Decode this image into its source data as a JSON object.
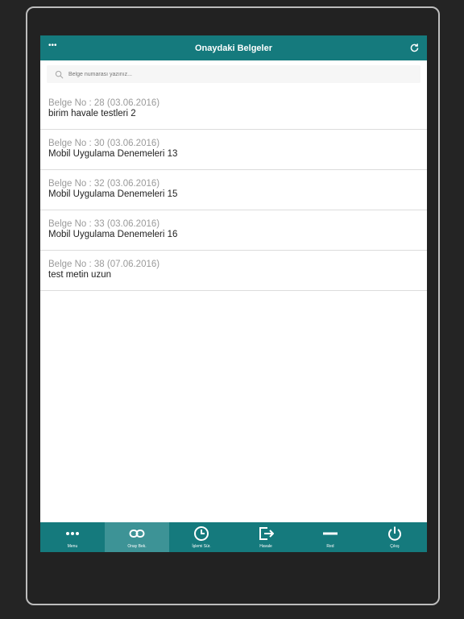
{
  "header": {
    "title": "Onaydaki Belgeler",
    "menu_icon": "ellipsis-icon",
    "refresh_icon": "refresh-icon"
  },
  "search": {
    "placeholder": "Belge numarası yazınız..."
  },
  "documents": [
    {
      "meta": "Belge No : 28 (03.06.2016)",
      "name": "birim havale testleri 2"
    },
    {
      "meta": "Belge No : 30 (03.06.2016)",
      "name": "Mobil Uygulama Denemeleri 13"
    },
    {
      "meta": "Belge No : 32 (03.06.2016)",
      "name": "Mobil Uygulama Denemeleri 15"
    },
    {
      "meta": "Belge No : 33 (03.06.2016)",
      "name": "Mobil Uygulama Denemeleri 16"
    },
    {
      "meta": "Belge No : 38 (07.06.2016)",
      "name": "test metin uzun"
    }
  ],
  "tabs": [
    {
      "label": "Menu",
      "icon": "more-dots-icon"
    },
    {
      "label": "Onay Bek.",
      "icon": "link-icon",
      "active": true
    },
    {
      "label": "İşlemi Sür.",
      "icon": "clock-icon"
    },
    {
      "label": "Havale",
      "icon": "forward-icon"
    },
    {
      "label": "Red",
      "icon": "minus-icon"
    },
    {
      "label": "Çıkış",
      "icon": "power-icon"
    }
  ],
  "colors": {
    "accent": "#157a7d",
    "active_tab": "#3d9396"
  }
}
